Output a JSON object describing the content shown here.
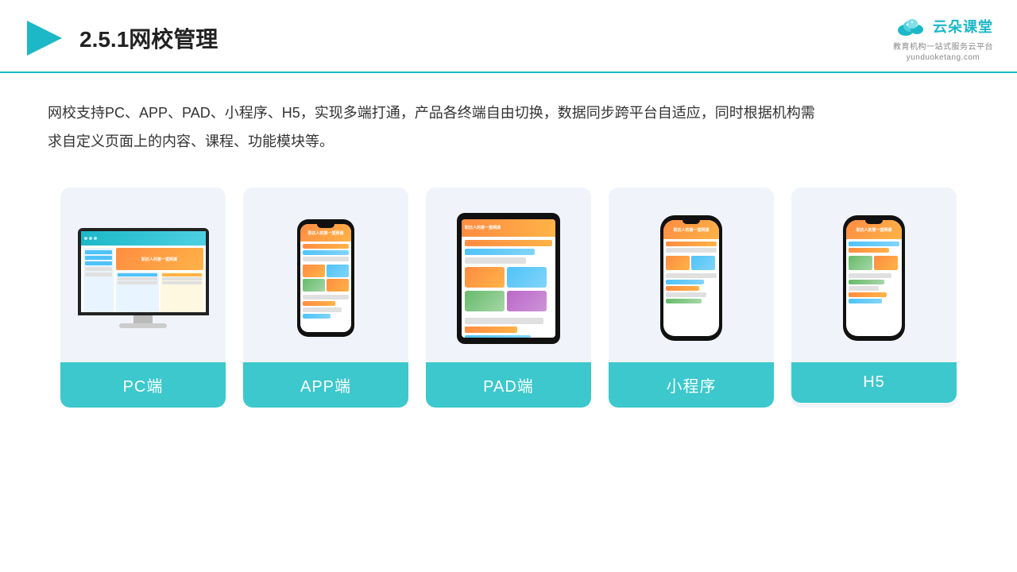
{
  "header": {
    "title": "2.5.1网校管理",
    "logo_main": "云朵课堂",
    "logo_url": "yunduoketang.com",
    "logo_sub": "教育机构一站式服务云平台"
  },
  "description": {
    "text": "网校支持PC、APP、PAD、小程序、H5，实现多端打通，产品各终端自由切换，数据同步跨平台自适应，同时根据机构需求自定义页面上的内容、课程、功能模块等。"
  },
  "cards": [
    {
      "label": "PC端",
      "type": "pc"
    },
    {
      "label": "APP端",
      "type": "phone"
    },
    {
      "label": "PAD端",
      "type": "tablet"
    },
    {
      "label": "小程序",
      "type": "phone2"
    },
    {
      "label": "H5",
      "type": "phone3"
    }
  ]
}
